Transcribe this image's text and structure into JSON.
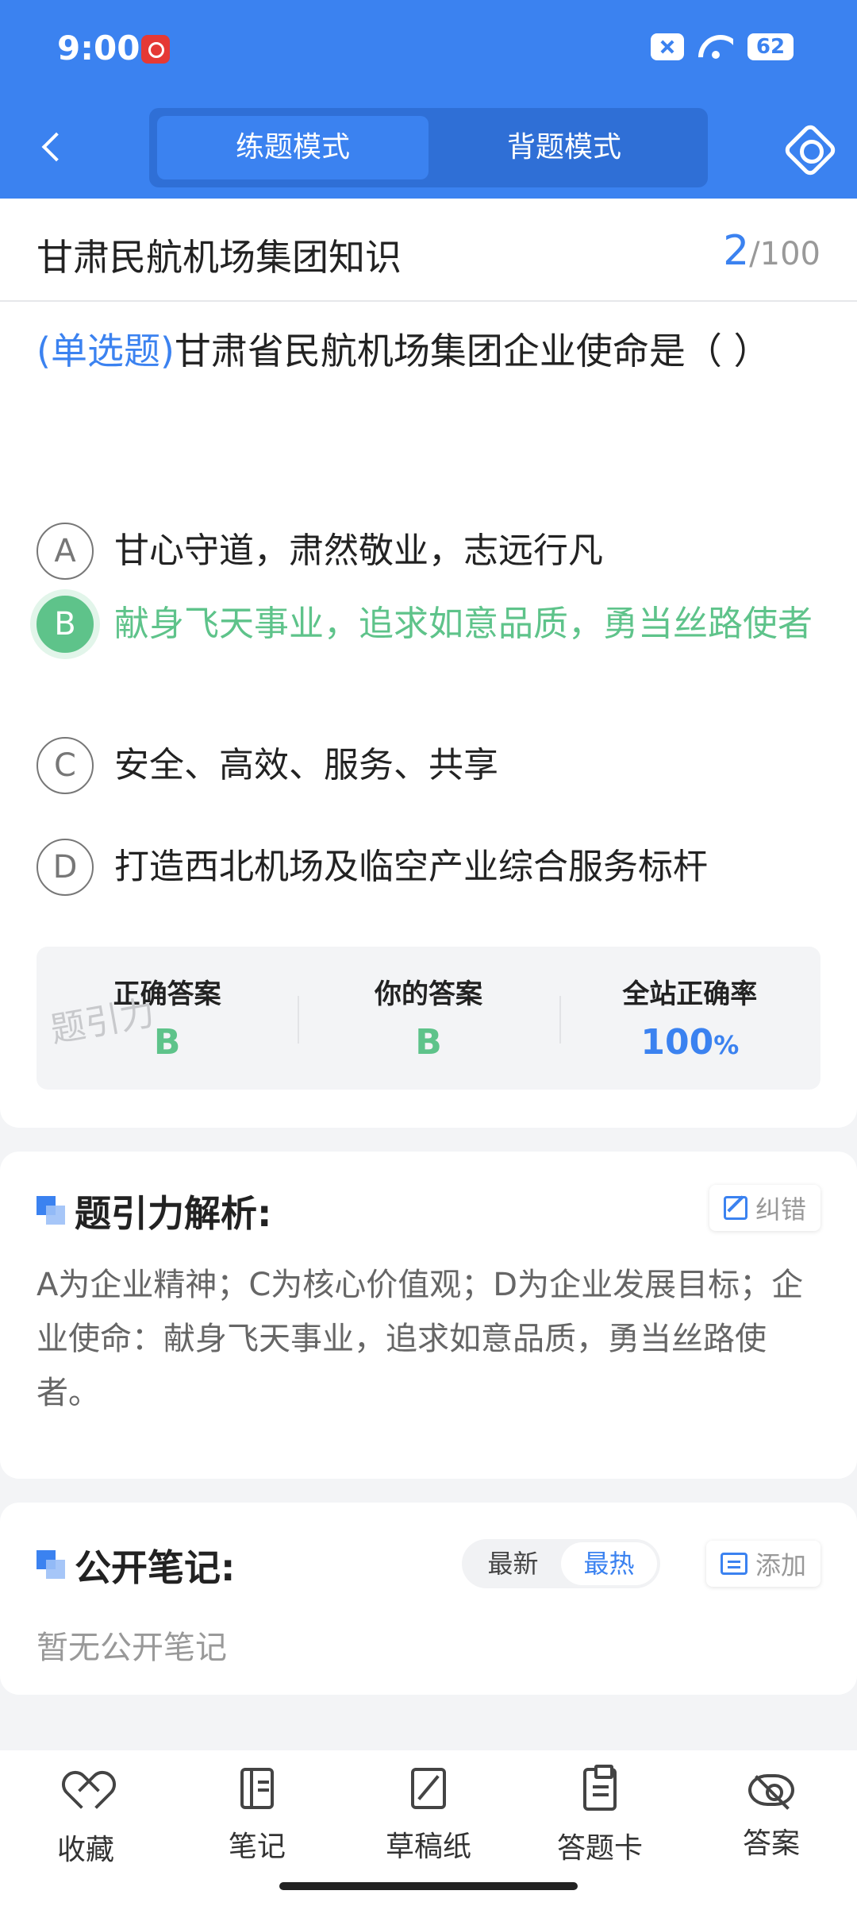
{
  "status_bar": {
    "time": "9:00",
    "battery": "62"
  },
  "header": {
    "tabs": [
      {
        "label": "练题模式",
        "active": true
      },
      {
        "label": "背题模式",
        "active": false
      }
    ]
  },
  "question": {
    "category": "甘肃民航机场集团知识",
    "current": "2",
    "total": "/100",
    "type": "(单选题)",
    "text": "甘肃省民航机场集团企业使命是（ ）",
    "options": [
      {
        "letter": "A",
        "text": "甘心守道，肃然敬业，志远行凡",
        "state": "normal"
      },
      {
        "letter": "B",
        "text": "献身飞天事业，追求如意品质，勇当丝路使者",
        "state": "correct"
      },
      {
        "letter": "C",
        "text": "安全、高效、服务、共享",
        "state": "normal"
      },
      {
        "letter": "D",
        "text": "打造西北机场及临空产业综合服务标杆",
        "state": "normal"
      }
    ]
  },
  "result": {
    "correct_label": "正确答案",
    "correct_value": "B",
    "yours_label": "你的答案",
    "yours_value": "B",
    "rate_label": "全站正确率",
    "rate_value": "100",
    "rate_unit": "%",
    "watermark": "题引力"
  },
  "analysis": {
    "title": "题引力解析:",
    "report_label": "纠错",
    "text": "A为企业精神；C为核心价值观；D为企业发展目标；企业使命：献身飞天事业，追求如意品质，勇当丝路使者。"
  },
  "notes": {
    "title": "公开笔记:",
    "sort_newest": "最新",
    "sort_hottest": "最热",
    "add_label": "添加",
    "empty_text": "暂无公开笔记"
  },
  "bottom_nav": [
    {
      "label": "收藏",
      "icon": "heart-icon"
    },
    {
      "label": "笔记",
      "icon": "notebook-icon"
    },
    {
      "label": "草稿纸",
      "icon": "draft-icon"
    },
    {
      "label": "答题卡",
      "icon": "answer-card-icon"
    },
    {
      "label": "答案",
      "icon": "eye-off-icon"
    }
  ],
  "colors": {
    "primary": "#3b82f0",
    "correct": "#5ec38a"
  }
}
